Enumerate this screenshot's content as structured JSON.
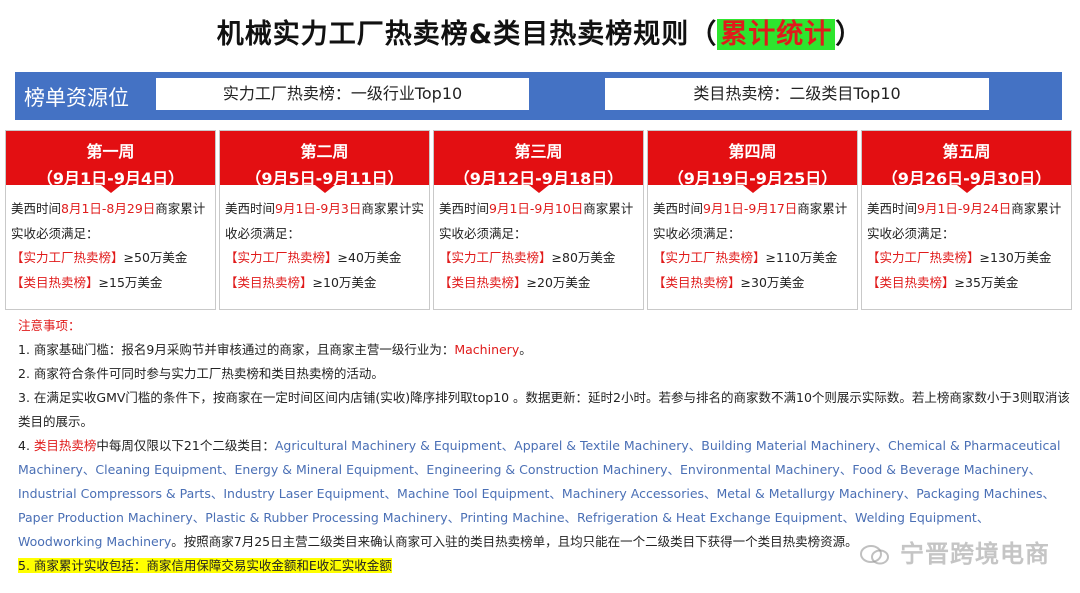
{
  "title": {
    "main": "机械实力工厂热卖榜&类目热卖榜规则（",
    "highlight": "累计统计",
    "end": "）"
  },
  "banner": {
    "label": "榜单资源位",
    "box1": "实力工厂热卖榜：一级行业Top10",
    "box2": "类目热卖榜：二级类目Top10"
  },
  "weeks": [
    {
      "name": "第一周",
      "range": "（9月1日-9月4日）",
      "p1": "美西时间",
      "dates": "8月1日-8月29日",
      "p2": "商家累计实收必须满足：",
      "t1": "【实力工厂热卖榜】",
      "v1": "≥50万美金",
      "t2": "【类目热卖榜】",
      "v2": "≥15万美金"
    },
    {
      "name": "第二周",
      "range": "（9月5日-9月11日）",
      "p1": "美西时间",
      "dates": "9月1日-9月3日",
      "p2": "商家累计实收必须满足：",
      "t1": "【实力工厂热卖榜】",
      "v1": "≥40万美金",
      "t2": "【类目热卖榜】",
      "v2": "≥10万美金"
    },
    {
      "name": "第三周",
      "range": "（9月12日-9月18日）",
      "p1": "美西时间",
      "dates": "9月1日-9月10日",
      "p2": "商家累计实收必须满足：",
      "t1": "【实力工厂热卖榜】",
      "v1": "≥80万美金",
      "t2": "【类目热卖榜】",
      "v2": "≥20万美金"
    },
    {
      "name": "第四周",
      "range": "（9月19日-9月25日）",
      "p1": "美西时间",
      "dates": "9月1日-9月17日",
      "p2": "商家累计实收必须满足：",
      "t1": "【实力工厂热卖榜】",
      "v1": "≥110万美金",
      "t2": "【类目热卖榜】",
      "v2": "≥30万美金"
    },
    {
      "name": "第五周",
      "range": "（9月26日-9月30日）",
      "p1": "美西时间",
      "dates": "9月1日-9月24日",
      "p2": "商家累计实收必须满足：",
      "t1": "【实力工厂热卖榜】",
      "v1": "≥130万美金",
      "t2": "【类目热卖榜】",
      "v2": "≥35万美金"
    }
  ],
  "notes": {
    "head": "注意事项：",
    "n1a": "1. 商家基础门槛：报名9月采购节并审核通过的商家，且商家主营一级行业为：",
    "n1b": "Machinery",
    "n1c": "。",
    "n2": "2. 商家符合条件可同时参与实力工厂热卖榜和类目热卖榜的活动。",
    "n3": "3. 在满足实收GMV门槛的条件下，按商家在一定时间区间内店铺(实收)降序排列取top10 。数据更新：延时2小时。若参与排名的商家数不满10个则展示实际数。若上榜商家数小于3则取消该类目的展示。",
    "n4a": "4. ",
    "n4b": "类目热卖榜",
    "n4c": "中每周仅限以下21个二级类目：",
    "n4d": "Agricultural Machinery & Equipment、Apparel & Textile Machinery、Building Material Machinery、Chemical & Pharmaceutical Machinery、Cleaning Equipment、Energy & Mineral Equipment、Engineering & Construction Machinery、Environmental Machinery、Food & Beverage Machinery、Industrial Compressors & Parts、Industry Laser Equipment、Machine Tool Equipment、Machinery Accessories、Metal & Metallurgy Machinery、Packaging Machines、Paper Production Machinery、Plastic & Rubber Processing Machinery、Printing Machine、Refrigeration & Heat Exchange Equipment、Welding Equipment、Woodworking Machinery",
    "n4e": "。按照商家7月25日主营二级类目来确认商家可入驻的类目热卖榜单，且均只能在一个二级类目下获得一个类目热卖榜资源。",
    "n5": "5. 商家累计实收包括：商家信用保障交易实收金额和E收汇实收金额"
  },
  "watermark": "宁晋跨境电商",
  "colors": {
    "red": "#e30f12",
    "blue": "#4472c4",
    "highlight_green": "#2ee52e",
    "link_blue": "#4a6fb5",
    "yellow": "#ffff00"
  }
}
